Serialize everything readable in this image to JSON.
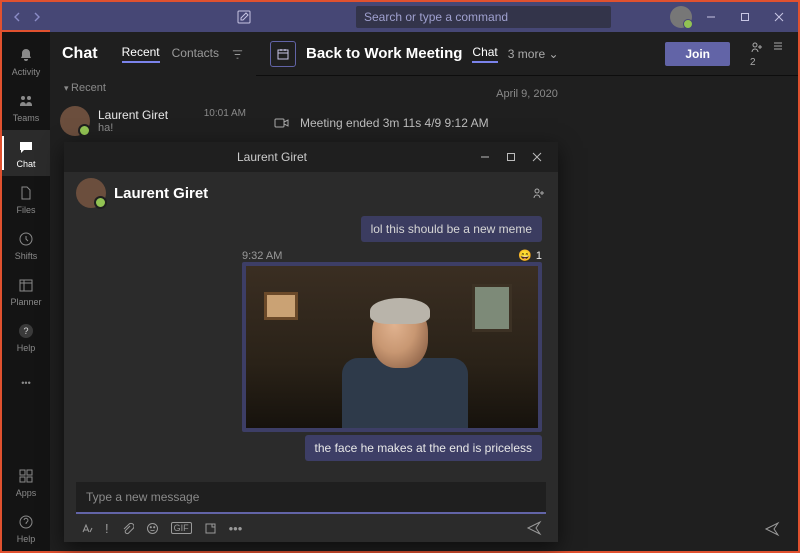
{
  "titlebar": {
    "search_placeholder": "Search or type a command"
  },
  "rail": {
    "activity": "Activity",
    "teams": "Teams",
    "chat": "Chat",
    "files": "Files",
    "shifts": "Shifts",
    "planner": "Planner",
    "help_top": "Help",
    "apps": "Apps",
    "help": "Help"
  },
  "chatlist": {
    "title": "Chat",
    "tab_recent": "Recent",
    "tab_contacts": "Contacts",
    "section_recent": "Recent",
    "items": [
      {
        "name": "Laurent Giret",
        "preview": "ha!",
        "time": "10:01 AM"
      }
    ]
  },
  "meeting": {
    "title": "Back to Work Meeting",
    "tab_chat": "Chat",
    "more_label": "3 more",
    "join_label": "Join",
    "participants_badge": "2",
    "date_separator": "April 9, 2020",
    "ended_line": "Meeting ended   3m 11s   4/9 9:12 AM"
  },
  "popout": {
    "window_title": "Laurent Giret",
    "header_name": "Laurent Giret",
    "prev_bubble": "lol this should be a new meme",
    "msg_time": "9:32 AM",
    "reaction_count": "1",
    "caption_bubble": "the face he makes at the end is priceless",
    "compose_placeholder": "Type a new message"
  }
}
